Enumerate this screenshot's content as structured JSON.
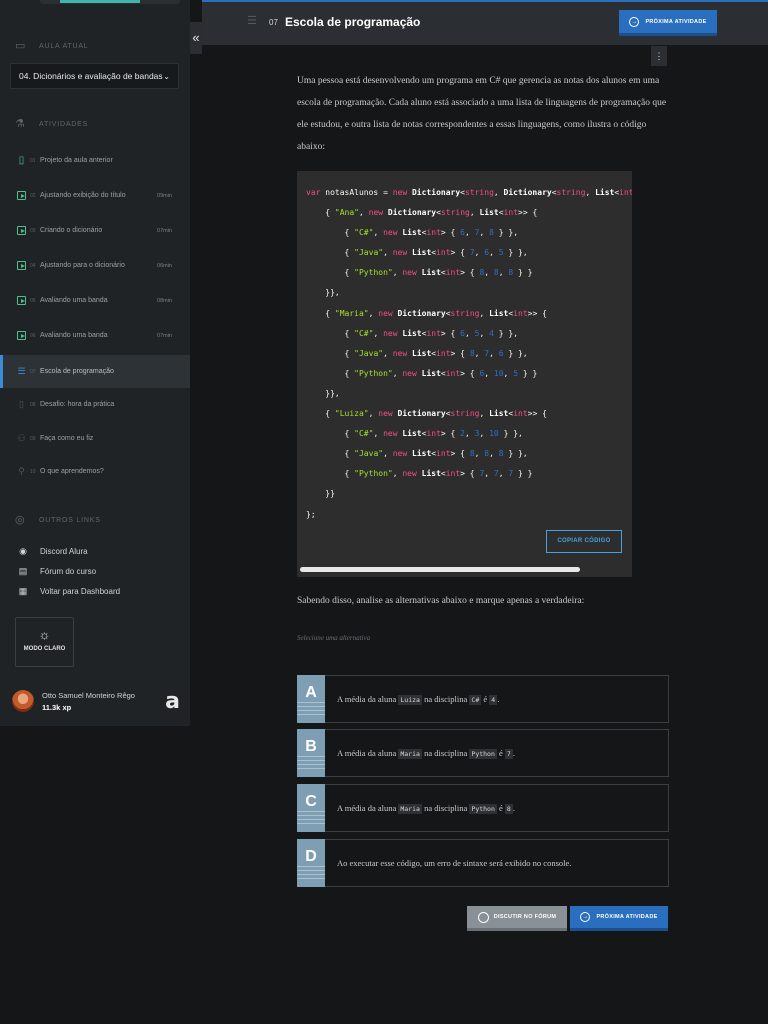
{
  "header": {
    "activity_number": "07",
    "title": "Escola de programação",
    "next_label": "PRÓXIMA ATIVIDADE"
  },
  "sidebar": {
    "collapse_glyph": "«",
    "current_lesson_heading": "AULA ATUAL",
    "current_lesson": "04. Dicionários e avaliação de bandas",
    "activities_heading": "ATIVIDADES",
    "activities": [
      {
        "num": "01",
        "label": "Projeto da aula anterior",
        "duration": "",
        "icon": "book-icon",
        "done": true
      },
      {
        "num": "02",
        "label": "Ajustando exibição do título",
        "duration": "09min",
        "icon": "video-icon",
        "done": true
      },
      {
        "num": "03",
        "label": "Criando o dicionário",
        "duration": "07min",
        "icon": "video-icon",
        "done": true
      },
      {
        "num": "04",
        "label": "Ajustando para o dicionário",
        "duration": "06min",
        "icon": "video-icon",
        "done": true
      },
      {
        "num": "05",
        "label": "Avaliando uma banda",
        "duration": "08min",
        "icon": "video-icon",
        "done": true
      },
      {
        "num": "06",
        "label": "Avaliando uma banda",
        "duration": "07min",
        "icon": "video-icon",
        "done": true
      },
      {
        "num": "07",
        "label": "Escola de programação",
        "duration": "",
        "icon": "list-icon",
        "done": false
      },
      {
        "num": "08",
        "label": "Desafio: hora da prática",
        "duration": "",
        "icon": "book-icon",
        "done": false
      },
      {
        "num": "09",
        "label": "Faça como eu fiz",
        "duration": "",
        "icon": "people-icon",
        "done": false
      },
      {
        "num": "10",
        "label": "O que aprendemos?",
        "duration": "",
        "icon": "user-icon",
        "done": false
      }
    ],
    "other_links_heading": "OUTROS LINKS",
    "links": [
      {
        "label": "Discord Alura",
        "icon": "discord-icon"
      },
      {
        "label": "Fórum do curso",
        "icon": "forum-icon"
      },
      {
        "label": "Voltar para Dashboard",
        "icon": "dashboard-icon"
      }
    ],
    "mode_label": "MODO CLARO",
    "user": {
      "name": "Otto Samuel Monteiro Rêgo",
      "xp": "11.3k xp"
    },
    "logo_glyph": "a"
  },
  "content": {
    "intro": "Uma pessoa está desenvolvendo um programa em C# que gerencia as notas dos alunos em uma escola de programação. Cada aluno está associado a uma lista de linguagens de programação que ele estudou, e outra lista de notas correspondentes a essas linguagens, como ilustra o código abaixo:",
    "copy_label": "COPIAR CÓDIGO",
    "question": "Sabendo disso, analise as alternativas abaixo e marque apenas a verdadeira:",
    "hint": "Selecione uma alternativa",
    "options": [
      {
        "letter": "A",
        "pre": "A média da aluna ",
        "c1": "Luiza",
        "mid": " na disciplina ",
        "c2": "C#",
        "mid2": " é ",
        "c3": "4",
        "post": "."
      },
      {
        "letter": "B",
        "pre": "A média da aluna ",
        "c1": "Maria",
        "mid": " na disciplina ",
        "c2": "Python",
        "mid2": " é ",
        "c3": "7",
        "post": "."
      },
      {
        "letter": "C",
        "pre": "A média da aluna ",
        "c1": "Maria",
        "mid": " na disciplina ",
        "c2": "Python",
        "mid2": " é ",
        "c3": "8",
        "post": "."
      },
      {
        "letter": "D",
        "text": "Ao executar esse código, um erro de sintaxe será exibido no console."
      }
    ],
    "forum_label": "DISCUTIR NO FÓRUM",
    "next_label": "PRÓXIMA ATIVIDADE"
  },
  "code": {
    "decl_var": "var",
    "decl_name": " notasAlunos = ",
    "decl_new": "new",
    "decl_type": "Dictionary",
    "decl_generic": "<string, Dictionary<string, List<int>>>",
    "students": [
      {
        "name": "\"Ana\"",
        "grades": [
          [
            "\"C#\"",
            "6",
            "7",
            "8"
          ],
          [
            "\"Java\"",
            "7",
            "6",
            "5"
          ],
          [
            "\"Python\"",
            "8",
            "8",
            "8"
          ]
        ]
      },
      {
        "name": "\"Maria\"",
        "grades": [
          [
            "\"C#\"",
            "6",
            "5",
            "4"
          ],
          [
            "\"Java\"",
            "8",
            "7",
            "6"
          ],
          [
            "\"Python\"",
            "6",
            "10",
            "5"
          ]
        ]
      },
      {
        "name": "\"Luiza\"",
        "grades": [
          [
            "\"C#\"",
            "2",
            "3",
            "10"
          ],
          [
            "\"Java\"",
            "8",
            "8",
            "8"
          ],
          [
            "\"Python\"",
            "7",
            "7",
            "7"
          ]
        ]
      }
    ]
  },
  "colors": {
    "accent_blue": "#2a6fbf",
    "done_green": "#4fc08d",
    "option_letter_bg": "#7e9eb3"
  }
}
